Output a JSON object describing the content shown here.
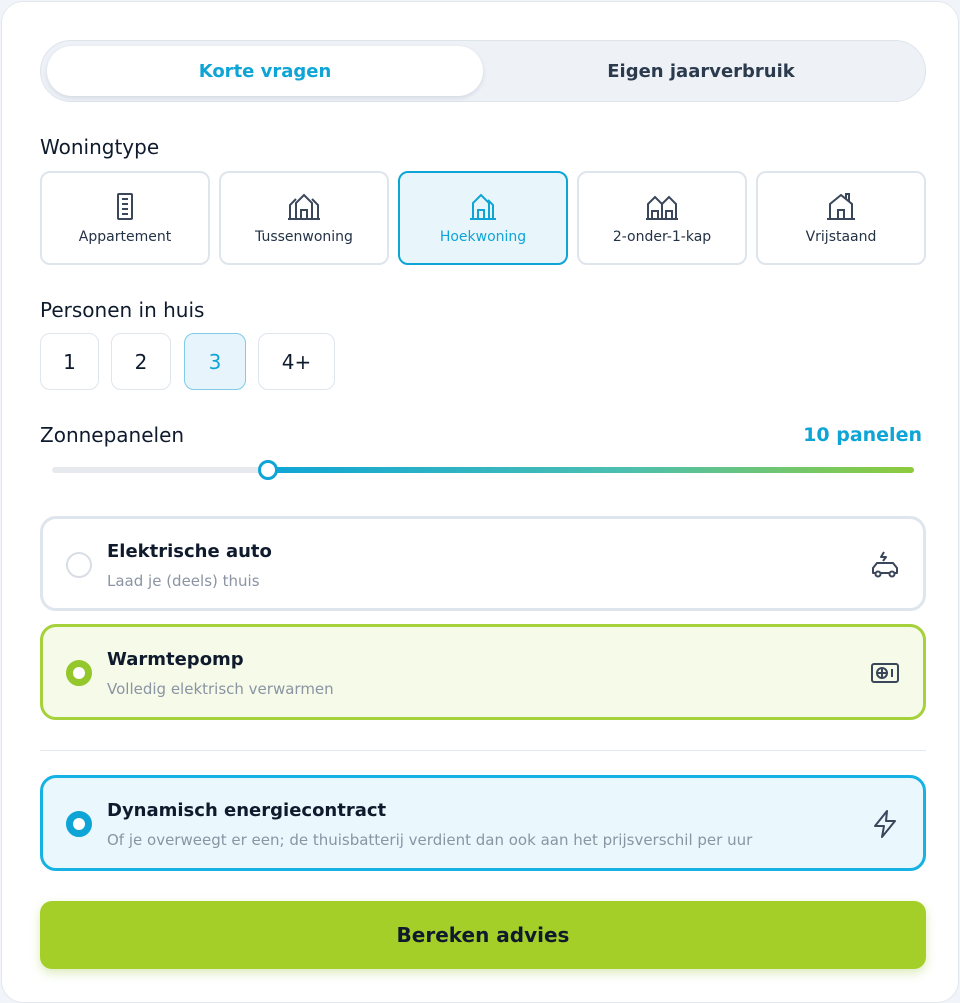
{
  "tabs": [
    {
      "label": "Korte vragen",
      "active": true
    },
    {
      "label": "Eigen jaarverbruik",
      "active": false
    }
  ],
  "woningtype": {
    "label": "Woningtype",
    "options": [
      {
        "label": "Appartement",
        "icon": "apartment-icon",
        "selected": false
      },
      {
        "label": "Tussenwoning",
        "icon": "terraced-house-icon",
        "selected": false
      },
      {
        "label": "Hoekwoning",
        "icon": "corner-house-icon",
        "selected": true
      },
      {
        "label": "2-onder-1-kap",
        "icon": "semi-detached-icon",
        "selected": false
      },
      {
        "label": "Vrijstaand",
        "icon": "detached-house-icon",
        "selected": false
      }
    ]
  },
  "personen": {
    "label": "Personen in huis",
    "options": [
      "1",
      "2",
      "3",
      "4+"
    ],
    "selected": "3"
  },
  "zonnepanelen": {
    "label": "Zonnepanelen",
    "value_text": "10 panelen",
    "slider_fraction": 0.25
  },
  "options": [
    {
      "title": "Elektrische auto",
      "subtitle": "Laad je (deels) thuis",
      "checked": false,
      "icon": "electric-car-icon"
    },
    {
      "title": "Warmtepomp",
      "subtitle": "Volledig elektrisch verwarmen",
      "checked": true,
      "icon": "heat-pump-icon"
    },
    {
      "title": "Dynamisch energiecontract",
      "subtitle": "Of je overweegt er een; de thuisbatterij verdient dan ook aan het prijsverschil per uur",
      "checked": true,
      "icon": "lightning-icon"
    }
  ],
  "cta": {
    "label": "Bereken advies"
  },
  "colors": {
    "accent": "#0ea5d6",
    "green": "#a3cf28",
    "text": "#0f1b2d",
    "muted": "#8a94a3"
  }
}
